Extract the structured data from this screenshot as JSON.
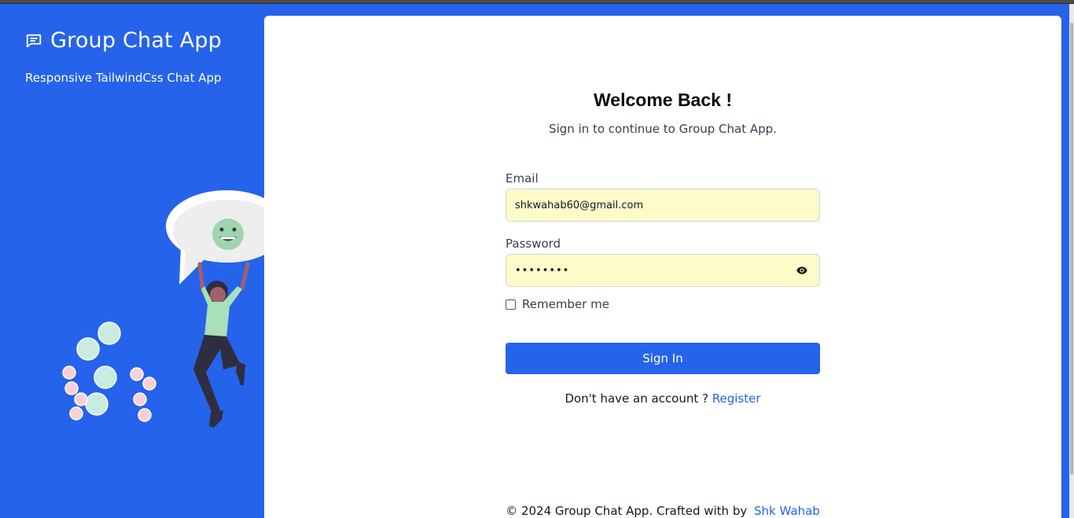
{
  "brand": {
    "title": "Group Chat App",
    "subtitle": "Responsive TailwindCss Chat App",
    "icon": "chat-icon"
  },
  "login": {
    "title": "Welcome Back !",
    "subtitle": "Sign in to continue to Group Chat App.",
    "email_label": "Email",
    "email_value": "shkwahab60@gmail.com",
    "password_label": "Password",
    "password_value": "password",
    "remember_label": "Remember me",
    "remember_checked": false,
    "submit_label": "Sign In",
    "register_prompt": "Don't have an account ? ",
    "register_link": "Register"
  },
  "footer": {
    "text": "© 2024 Group Chat App. Crafted with by ",
    "author": "Shk Wahab"
  },
  "colors": {
    "primary": "#2563eb",
    "input_autofill": "#fefbc9",
    "white": "#ffffff"
  }
}
